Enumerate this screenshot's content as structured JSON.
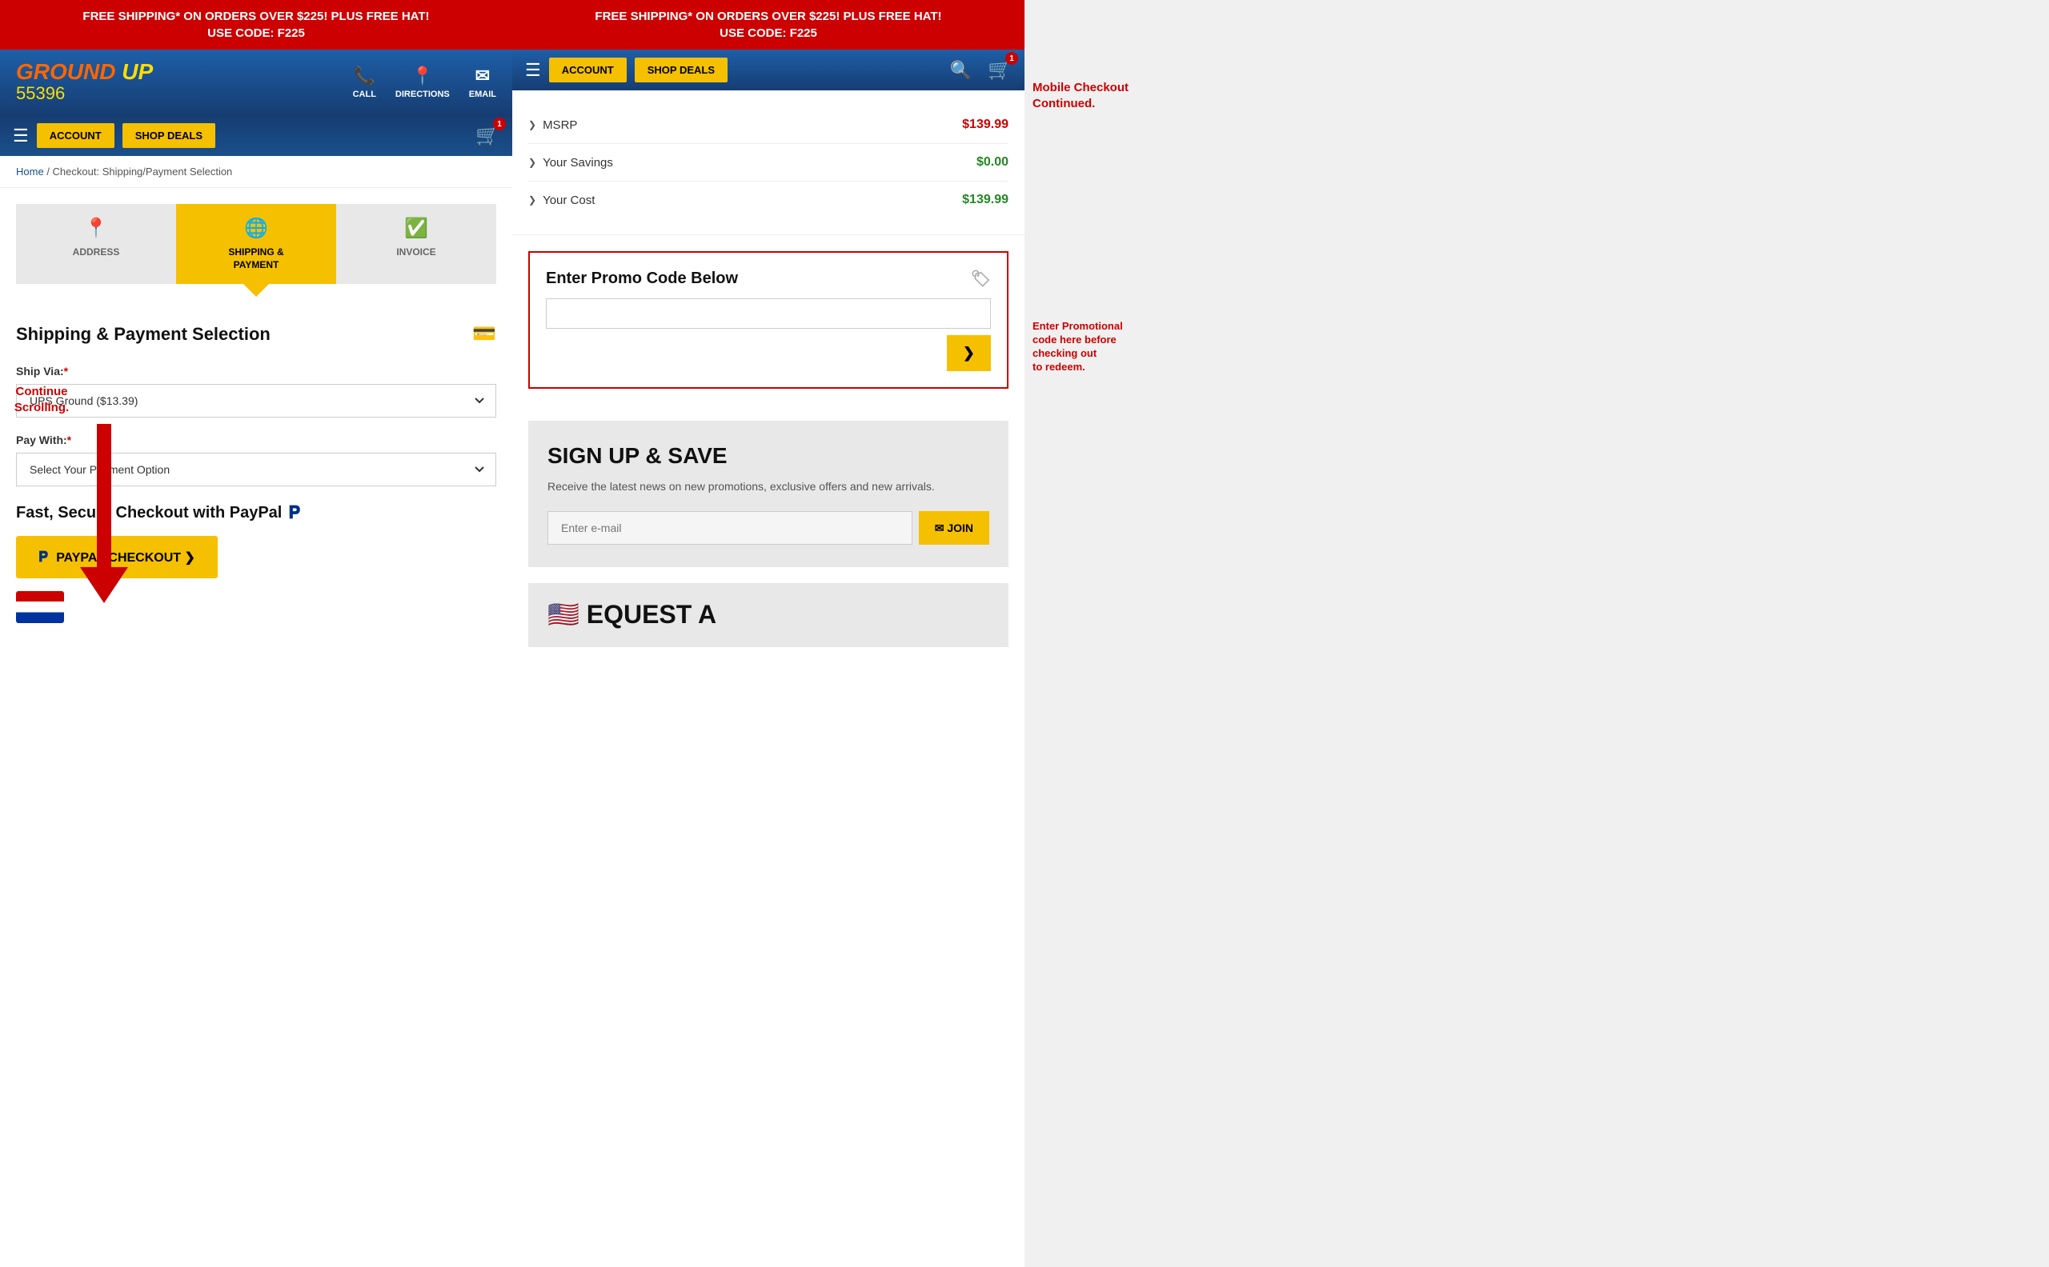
{
  "promos": {
    "banner_left": "FREE SHIPPING* ON ORDERS OVER $225! PLUS FREE HAT!",
    "banner_left2": "USE CODE: F225",
    "banner_right": "FREE SHIPPING* ON ORDERS OVER $225! PLUS FREE HAT!",
    "banner_right2": "USE CODE: F225"
  },
  "nav_left": {
    "logo_ground": "GROUND",
    "logo_up": "UP",
    "logo_number": "55396",
    "call_label": "CALL",
    "directions_label": "DIRECTIONS",
    "email_label": "EMAIL",
    "account_btn": "ACCOUNT",
    "shop_deals_btn": "SHOP DEALS",
    "cart_badge": "1"
  },
  "nav_right": {
    "account_btn": "ACCOUNT",
    "shop_deals_btn": "SHOP DEALS",
    "cart_badge": "1"
  },
  "breadcrumb": {
    "home": "Home",
    "separator": " / ",
    "current": "Checkout: Shipping/Payment Selection"
  },
  "steps": {
    "address_label": "ADDRESS",
    "shipping_label": "SHIPPING &\nPAYMENT",
    "invoice_label": "INVOICE"
  },
  "shipping_section": {
    "title": "Shipping & Payment Selection",
    "ship_via_label": "Ship Via:",
    "ship_via_required": "*",
    "ship_via_value": "UPS Ground ($13.39)",
    "pay_with_label": "Pay With:",
    "pay_with_required": "*",
    "pay_with_placeholder": "Select Your Payment Option",
    "paypal_header": "Fast, Secure Checkout with PayPal",
    "paypal_btn_label": "PAYPAL CHECKOUT ❯"
  },
  "price_summary": {
    "msrp_label": "MSRP",
    "msrp_value": "$139.99",
    "savings_label": "Your Savings",
    "savings_value": "$0.00",
    "cost_label": "Your Cost",
    "cost_value": "$139.99"
  },
  "promo": {
    "title": "Enter Promo Code Below",
    "input_placeholder": "",
    "submit_symbol": "❯"
  },
  "signup": {
    "title": "SIGN UP & SAVE",
    "description": "Receive the latest news on new promotions, exclusive offers and new arrivals.",
    "email_placeholder": "Enter e-mail",
    "join_btn": "✉ JOIN"
  },
  "request": {
    "text": "EQUEST A"
  },
  "annotations": {
    "continue_scrolling": "Continue\nScrolling.",
    "mobile_checkout": "Mobile Checkout\nContinued.",
    "promo_note": "Enter Promotional\ncode here before\nchecking out\nto redeem."
  }
}
